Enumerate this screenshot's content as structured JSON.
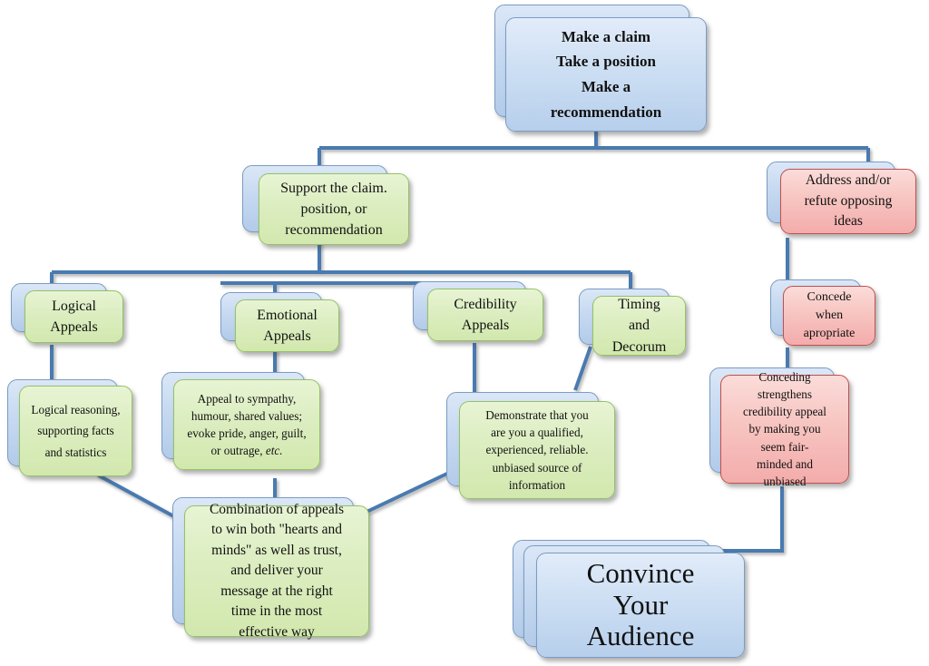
{
  "diagram": {
    "title": "Persuasive Argument Flowchart",
    "colors": {
      "blue_fill": "#c6d9f1",
      "blue_border": "#7b9cc4",
      "green_fill": "#d2e8ae",
      "green_border": "#93c264",
      "red_fill": "#f3acab",
      "red_border": "#c0504d",
      "connector": "#4a7ab0",
      "arrow": "#4a86c8",
      "background": "#ffffff",
      "text": "#111111"
    },
    "nodes": {
      "claim": {
        "id": "make-a-claim",
        "style": "blue",
        "lines": [
          "Make a claim",
          "Take a position",
          "Make a",
          "recommendation"
        ]
      },
      "support": {
        "id": "support-the-claim",
        "style": "green",
        "lines": [
          "Support the claim.",
          "position, or",
          "recommendation"
        ]
      },
      "refute": {
        "id": "address-refute-opposing-ideas",
        "style": "red",
        "lines": [
          "Address and/or",
          "refute opposing",
          "ideas"
        ]
      },
      "logical": {
        "id": "logical-appeals",
        "style": "green",
        "lines": [
          "Logical",
          "Appeals"
        ]
      },
      "emotional": {
        "id": "emotional-appeals",
        "style": "green",
        "lines": [
          "Emotional",
          "Appeals"
        ]
      },
      "credibility": {
        "id": "credibility-appeals",
        "style": "green",
        "lines": [
          "Credibility",
          "Appeals"
        ]
      },
      "timing": {
        "id": "timing-and-decorum",
        "style": "green",
        "lines": [
          "Timing",
          "and",
          "Decorum"
        ]
      },
      "concede": {
        "id": "concede-when-appropriate",
        "style": "red",
        "lines": [
          "Concede",
          "when",
          "apropriate"
        ]
      },
      "logical_detail": {
        "id": "logical-reasoning-detail",
        "style": "green",
        "lines": [
          "Logical reasoning,",
          "supporting facts",
          "and statistics"
        ]
      },
      "emotional_detail": {
        "id": "emotional-appeal-detail",
        "style": "green",
        "lines": [
          "Appeal to sympathy,",
          "humour, shared values;",
          "evoke pride, anger, guilt,",
          "or outrage, "
        ],
        "italic_tail": "etc."
      },
      "credibility_detail": {
        "id": "credibility-demonstrate-detail",
        "style": "green",
        "lines": [
          "Demonstrate that you",
          "are you a qualified,",
          "experienced, reliable.",
          "unbiased source of",
          "information"
        ]
      },
      "conceding_detail": {
        "id": "conceding-strengthens-detail",
        "style": "red",
        "lines": [
          "Conceding",
          "strengthens",
          "credibility appeal",
          "by making you",
          "seem fair-",
          "minded and",
          "unbiased"
        ]
      },
      "combination": {
        "id": "combination-of-appeals",
        "style": "green",
        "lines": [
          "Combination of appeals",
          "to win both \"hearts and",
          "minds\" as well as trust,",
          "and deliver your",
          "message at the right",
          "time in the most",
          "effective way"
        ]
      },
      "convince": {
        "id": "convince-your-audience",
        "style": "blue",
        "lines": [
          "Convince",
          "Your",
          "Audience"
        ]
      }
    }
  }
}
